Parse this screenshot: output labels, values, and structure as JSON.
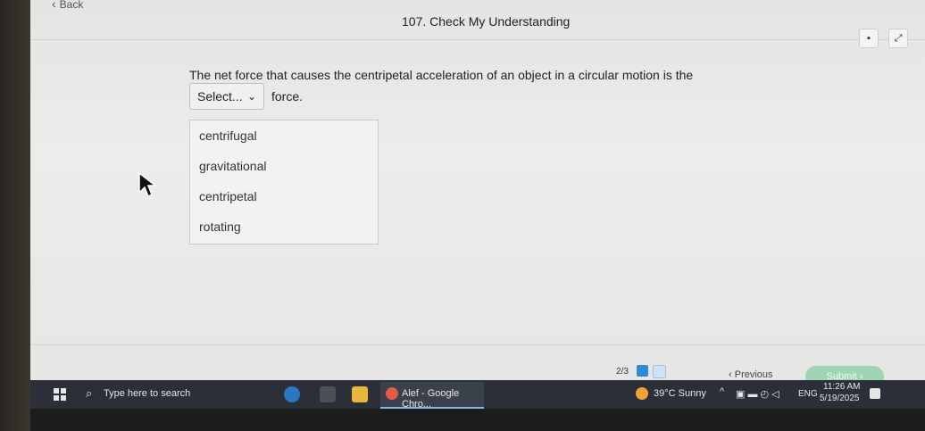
{
  "header": {
    "back_label": "Back",
    "title": "107. Check My Understanding"
  },
  "question": {
    "text": "The net force that causes the centripetal acceleration of an object in a circular motion is the",
    "select_value": "Select...",
    "after_text": "force.",
    "options": [
      "centrifugal",
      "gravitational",
      "centripetal",
      "rotating"
    ]
  },
  "footer": {
    "progress": "2/3",
    "previous_label": "Previous",
    "submit_label": "Submit"
  },
  "taskbar": {
    "search_placeholder": "Type here to search",
    "chrome_label": "Alef - Google Chro...",
    "weather": "39°C Sunny",
    "lang": "ENG",
    "time": "11:26 AM",
    "date": "5/19/2025"
  },
  "colors": {
    "accent": "#2a8bd6",
    "submit_bg": "#9fd4b4",
    "taskbar_bg": "#2a2f38"
  }
}
